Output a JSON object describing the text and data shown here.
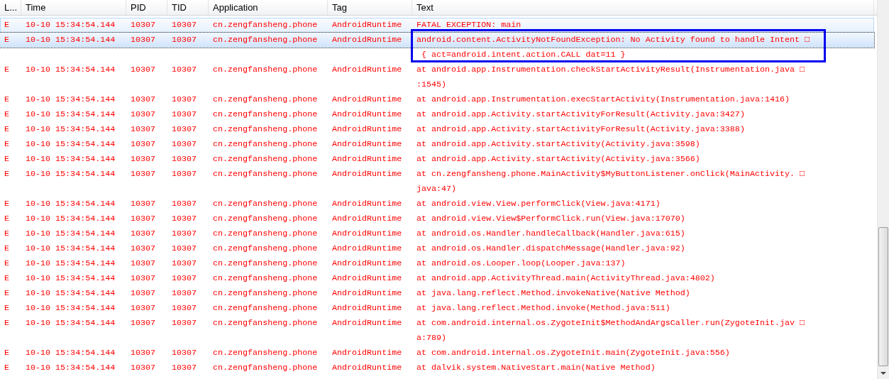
{
  "columns": [
    "L...",
    "Time",
    "PID",
    "TID",
    "Application",
    "Tag",
    "Text"
  ],
  "rows": [
    {
      "level": "E",
      "time": "10-10 15:34:54.144",
      "pid": "10307",
      "tid": "10307",
      "application": "cn.zengfansheng.phone",
      "tag": "AndroidRuntime",
      "text": [
        "FATAL EXCEPTION: main"
      ],
      "hovered": true,
      "selected": false,
      "annotated": false
    },
    {
      "level": "E",
      "time": "10-10 15:34:54.144",
      "pid": "10307",
      "tid": "10307",
      "application": "cn.zengfansheng.phone",
      "tag": "AndroidRuntime",
      "text": [
        "android.content.ActivityNotFoundException: No Activity found to handle Intent □",
        " { act=android.intent.action.CALL dat=11 }"
      ],
      "hovered": false,
      "selected": true,
      "annotated": true
    },
    {
      "level": "E",
      "time": "10-10 15:34:54.144",
      "pid": "10307",
      "tid": "10307",
      "application": "cn.zengfansheng.phone",
      "tag": "AndroidRuntime",
      "text": [
        "at android.app.Instrumentation.checkStartActivityResult(Instrumentation.java □",
        ":1545)"
      ],
      "hovered": false,
      "selected": false,
      "annotated": false
    },
    {
      "level": "E",
      "time": "10-10 15:34:54.144",
      "pid": "10307",
      "tid": "10307",
      "application": "cn.zengfansheng.phone",
      "tag": "AndroidRuntime",
      "text": [
        "at android.app.Instrumentation.execStartActivity(Instrumentation.java:1416)"
      ],
      "hovered": false,
      "selected": false,
      "annotated": false
    },
    {
      "level": "E",
      "time": "10-10 15:34:54.144",
      "pid": "10307",
      "tid": "10307",
      "application": "cn.zengfansheng.phone",
      "tag": "AndroidRuntime",
      "text": [
        "at android.app.Activity.startActivityForResult(Activity.java:3427)"
      ],
      "hovered": false,
      "selected": false,
      "annotated": false
    },
    {
      "level": "E",
      "time": "10-10 15:34:54.144",
      "pid": "10307",
      "tid": "10307",
      "application": "cn.zengfansheng.phone",
      "tag": "AndroidRuntime",
      "text": [
        "at android.app.Activity.startActivityForResult(Activity.java:3388)"
      ],
      "hovered": false,
      "selected": false,
      "annotated": false
    },
    {
      "level": "E",
      "time": "10-10 15:34:54.144",
      "pid": "10307",
      "tid": "10307",
      "application": "cn.zengfansheng.phone",
      "tag": "AndroidRuntime",
      "text": [
        "at android.app.Activity.startActivity(Activity.java:3598)"
      ],
      "hovered": false,
      "selected": false,
      "annotated": false
    },
    {
      "level": "E",
      "time": "10-10 15:34:54.144",
      "pid": "10307",
      "tid": "10307",
      "application": "cn.zengfansheng.phone",
      "tag": "AndroidRuntime",
      "text": [
        "at android.app.Activity.startActivity(Activity.java:3566)"
      ],
      "hovered": false,
      "selected": false,
      "annotated": false
    },
    {
      "level": "E",
      "time": "10-10 15:34:54.144",
      "pid": "10307",
      "tid": "10307",
      "application": "cn.zengfansheng.phone",
      "tag": "AndroidRuntime",
      "text": [
        "at cn.zengfansheng.phone.MainActivity$MyButtonListener.onClick(MainActivity. □",
        "java:47)"
      ],
      "hovered": false,
      "selected": false,
      "annotated": false
    },
    {
      "level": "E",
      "time": "10-10 15:34:54.144",
      "pid": "10307",
      "tid": "10307",
      "application": "cn.zengfansheng.phone",
      "tag": "AndroidRuntime",
      "text": [
        "at android.view.View.performClick(View.java:4171)"
      ],
      "hovered": false,
      "selected": false,
      "annotated": false
    },
    {
      "level": "E",
      "time": "10-10 15:34:54.144",
      "pid": "10307",
      "tid": "10307",
      "application": "cn.zengfansheng.phone",
      "tag": "AndroidRuntime",
      "text": [
        "at android.view.View$PerformClick.run(View.java:17070)"
      ],
      "hovered": false,
      "selected": false,
      "annotated": false
    },
    {
      "level": "E",
      "time": "10-10 15:34:54.144",
      "pid": "10307",
      "tid": "10307",
      "application": "cn.zengfansheng.phone",
      "tag": "AndroidRuntime",
      "text": [
        "at android.os.Handler.handleCallback(Handler.java:615)"
      ],
      "hovered": false,
      "selected": false,
      "annotated": false
    },
    {
      "level": "E",
      "time": "10-10 15:34:54.144",
      "pid": "10307",
      "tid": "10307",
      "application": "cn.zengfansheng.phone",
      "tag": "AndroidRuntime",
      "text": [
        "at android.os.Handler.dispatchMessage(Handler.java:92)"
      ],
      "hovered": false,
      "selected": false,
      "annotated": false
    },
    {
      "level": "E",
      "time": "10-10 15:34:54.144",
      "pid": "10307",
      "tid": "10307",
      "application": "cn.zengfansheng.phone",
      "tag": "AndroidRuntime",
      "text": [
        "at android.os.Looper.loop(Looper.java:137)"
      ],
      "hovered": false,
      "selected": false,
      "annotated": false
    },
    {
      "level": "E",
      "time": "10-10 15:34:54.144",
      "pid": "10307",
      "tid": "10307",
      "application": "cn.zengfansheng.phone",
      "tag": "AndroidRuntime",
      "text": [
        "at android.app.ActivityThread.main(ActivityThread.java:4802)"
      ],
      "hovered": false,
      "selected": false,
      "annotated": false
    },
    {
      "level": "E",
      "time": "10-10 15:34:54.144",
      "pid": "10307",
      "tid": "10307",
      "application": "cn.zengfansheng.phone",
      "tag": "AndroidRuntime",
      "text": [
        "at java.lang.reflect.Method.invokeNative(Native Method)"
      ],
      "hovered": false,
      "selected": false,
      "annotated": false
    },
    {
      "level": "E",
      "time": "10-10 15:34:54.144",
      "pid": "10307",
      "tid": "10307",
      "application": "cn.zengfansheng.phone",
      "tag": "AndroidRuntime",
      "text": [
        "at java.lang.reflect.Method.invoke(Method.java:511)"
      ],
      "hovered": false,
      "selected": false,
      "annotated": false
    },
    {
      "level": "E",
      "time": "10-10 15:34:54.144",
      "pid": "10307",
      "tid": "10307",
      "application": "cn.zengfansheng.phone",
      "tag": "AndroidRuntime",
      "text": [
        "at com.android.internal.os.ZygoteInit$MethodAndArgsCaller.run(ZygoteInit.jav □",
        "a:789)"
      ],
      "hovered": false,
      "selected": false,
      "annotated": false
    },
    {
      "level": "E",
      "time": "10-10 15:34:54.144",
      "pid": "10307",
      "tid": "10307",
      "application": "cn.zengfansheng.phone",
      "tag": "AndroidRuntime",
      "text": [
        "at com.android.internal.os.ZygoteInit.main(ZygoteInit.java:556)"
      ],
      "hovered": false,
      "selected": false,
      "annotated": false
    },
    {
      "level": "E",
      "time": "10-10 15:34:54.144",
      "pid": "10307",
      "tid": "10307",
      "application": "cn.zengfansheng.phone",
      "tag": "AndroidRuntime",
      "text": [
        "at dalvik.system.NativeStart.main(Native Method)"
      ],
      "hovered": false,
      "selected": false,
      "annotated": false
    }
  ]
}
